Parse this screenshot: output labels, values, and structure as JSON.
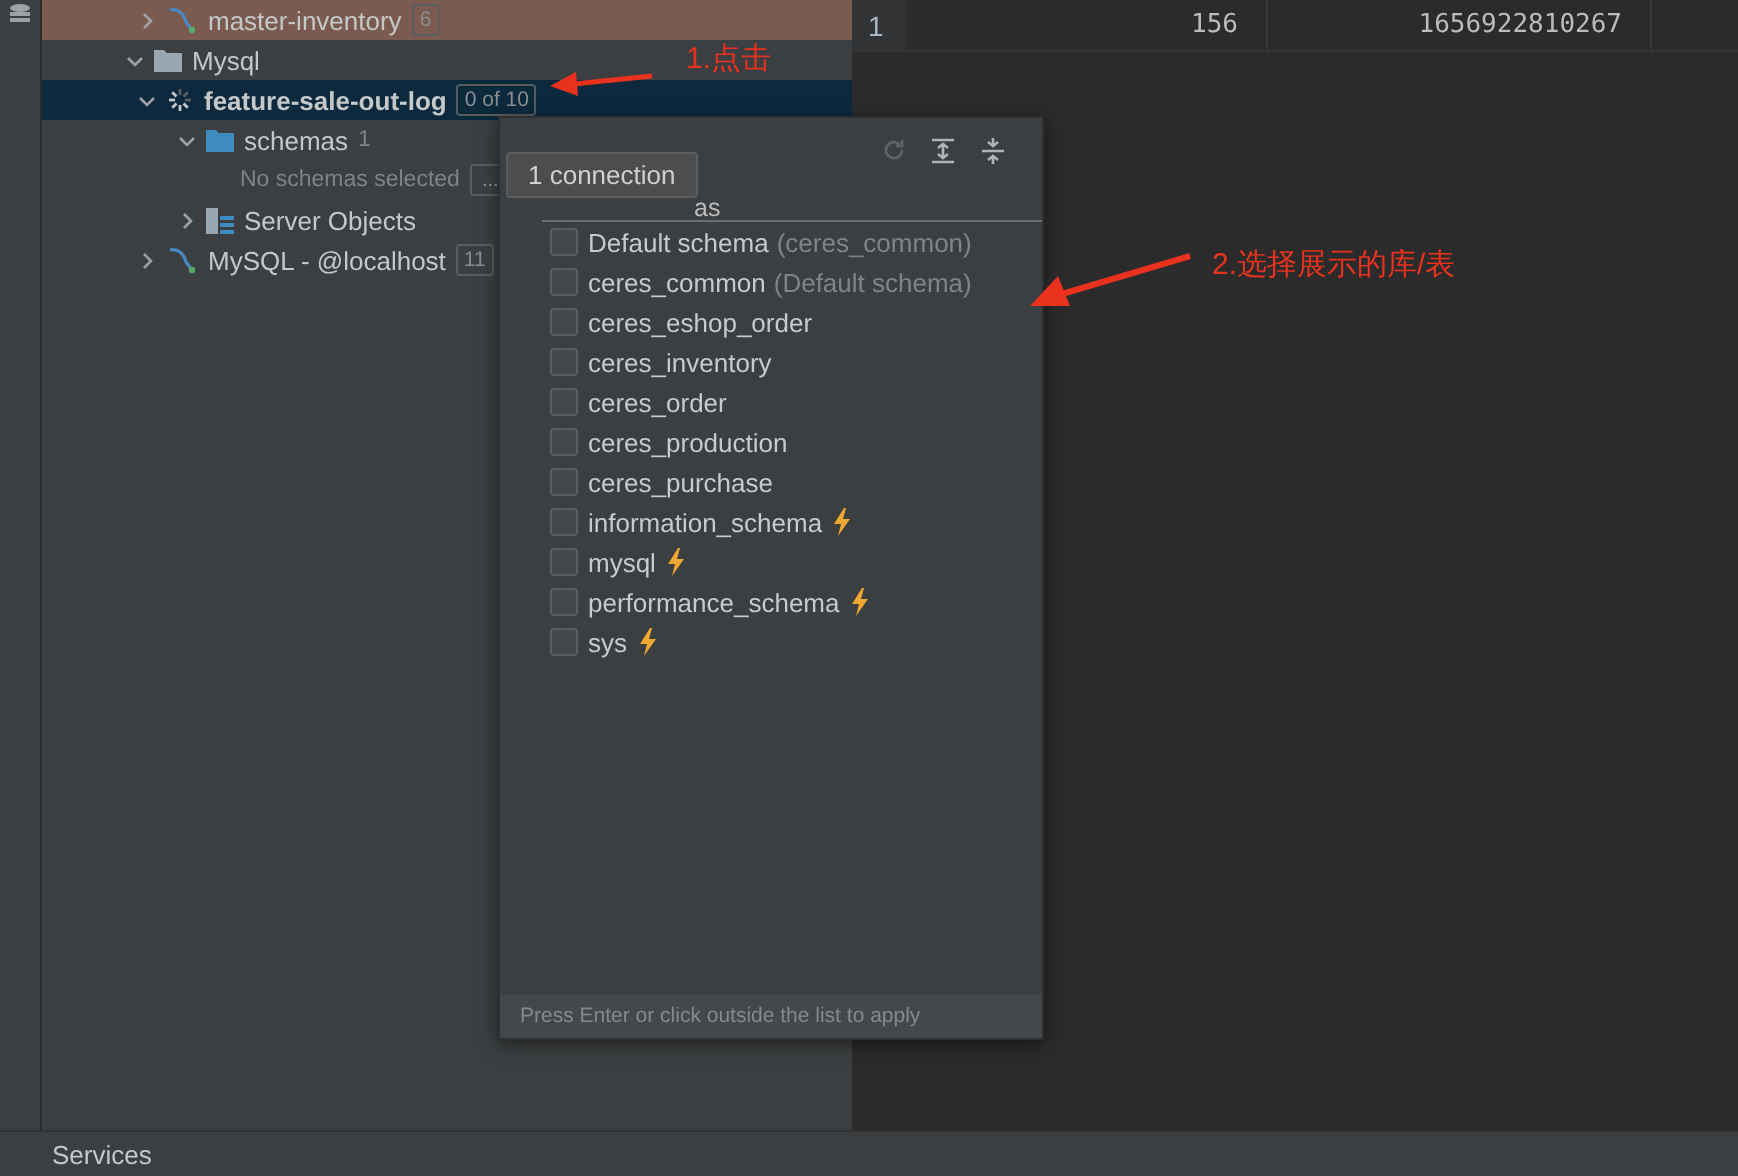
{
  "tree": [
    {
      "label": "master-inventory",
      "kind": "datasource",
      "badge": "6",
      "expanded": false,
      "selected": false,
      "color": "#7b5b4f"
    },
    {
      "label": "Mysql",
      "kind": "folder",
      "expanded": true,
      "selected": false,
      "children": [
        {
          "label": "feature-sale-out-log",
          "kind": "connecting",
          "badge": "0 of 10",
          "expanded": true,
          "selected": true,
          "children": [
            {
              "label": "schemas",
              "kind": "schemas",
              "count": "1",
              "expanded": true,
              "selected": false,
              "children": [
                {
                  "label": "No schemas selected",
                  "kind": "empty",
                  "action": "..."
                }
              ]
            },
            {
              "label": "Server Objects",
              "kind": "objects",
              "expanded": false,
              "selected": false
            }
          ]
        },
        {
          "label": "MySQL - @localhost",
          "kind": "datasource",
          "badge": "11",
          "expanded": false,
          "selected": false
        }
      ]
    }
  ],
  "grid": {
    "rows": [
      {
        "number": "1",
        "cells": [
          "156",
          "1656922810267"
        ]
      }
    ]
  },
  "popup": {
    "tooltip": "1 connection",
    "header": "as",
    "items": [
      {
        "label": "Default schema",
        "hint": "(ceres_common)",
        "checked": false,
        "system": false
      },
      {
        "label": "ceres_common",
        "hint": "(Default schema)",
        "checked": false,
        "system": false
      },
      {
        "label": "ceres_eshop_order",
        "checked": false,
        "system": false
      },
      {
        "label": "ceres_inventory",
        "checked": false,
        "system": false
      },
      {
        "label": "ceres_order",
        "checked": false,
        "system": false
      },
      {
        "label": "ceres_production",
        "checked": false,
        "system": false
      },
      {
        "label": "ceres_purchase",
        "checked": false,
        "system": false
      },
      {
        "label": "information_schema",
        "checked": false,
        "system": true
      },
      {
        "label": "mysql",
        "checked": false,
        "system": true
      },
      {
        "label": "performance_schema",
        "checked": false,
        "system": true
      },
      {
        "label": "sys",
        "checked": false,
        "system": true
      }
    ],
    "footer": "Press Enter or click outside the list to apply"
  },
  "annotations": [
    "1.点击",
    "2.选择展示的库/表"
  ],
  "bottom_panel": {
    "title": "Services"
  }
}
